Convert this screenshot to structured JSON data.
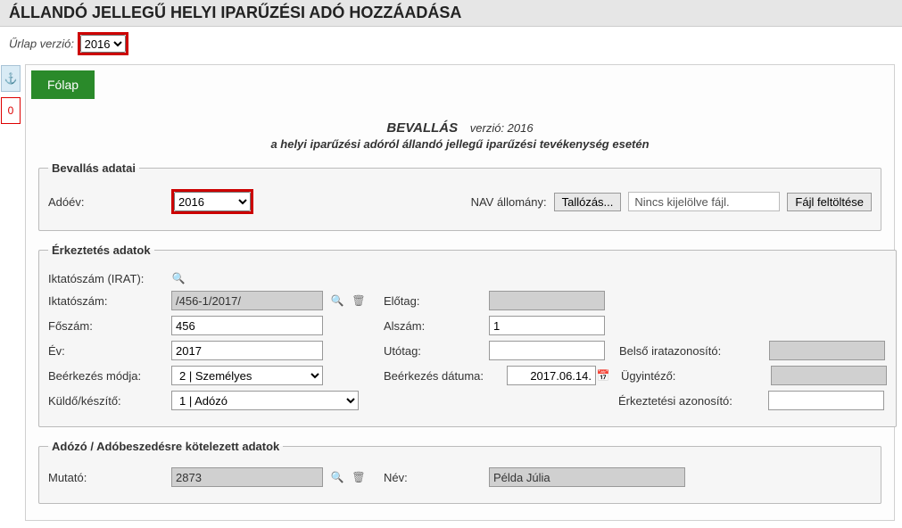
{
  "header": {
    "title": "ÁLLANDÓ JELLEGŰ HELYI IPARŰZÉSI ADÓ HOZZÁADÁSA"
  },
  "version": {
    "label": "Űrlap verzió:",
    "selected": "2016"
  },
  "sideFlags": {
    "anchor_icon": "⚓",
    "error_count": "0"
  },
  "tabs": {
    "main": "Fólap"
  },
  "docTitle": {
    "bevallas": "BEVALLÁS",
    "verzio": "verzió: 2016",
    "subtitle": "a helyi iparűzési adóról állandó jellegű iparűzési tevékenység esetén"
  },
  "group1": {
    "legend": "Bevallás adatai",
    "adoev_label": "Adóév:",
    "adoev_value": "2016",
    "nav_label": "NAV állomány:",
    "browse_btn": "Tallózás...",
    "file_status": "Nincs kijelölve fájl.",
    "upload_btn": "Fájl feltöltése"
  },
  "group2": {
    "legend": "Érkeztetés adatok",
    "iktatoszam_irat_label": "Iktatószám (IRAT):",
    "iktatoszam_label": "Iktatószám:",
    "iktatoszam_value": "/456-1/2017/",
    "elotag_label": "Előtag:",
    "elotag_value": "",
    "foszam_label": "Főszám:",
    "foszam_value": "456",
    "alszam_label": "Alszám:",
    "alszam_value": "1",
    "ev_label": "Év:",
    "ev_value": "2017",
    "utotag_label": "Utótag:",
    "utotag_value": "",
    "belso_label": "Belső iratazonosító:",
    "belso_value": "",
    "beerkezes_modja_label": "Beérkezés módja:",
    "beerkezes_modja_value": "2 | Személyes",
    "beerkezes_datuma_label": "Beérkezés dátuma:",
    "beerkezes_datuma_value": "2017.06.14.",
    "ugyintezo_label": "Ügyintéző:",
    "ugyintezo_value": "",
    "kuldo_label": "Küldő/készítő:",
    "kuldo_value": "1 | Adózó",
    "erk_azon_label": "Érkeztetési azonosító:",
    "erk_azon_value": ""
  },
  "group3": {
    "legend": "Adózó / Adóbeszedésre kötelezett adatok",
    "mutato_label": "Mutató:",
    "mutato_value": "2873",
    "nev_label": "Név:",
    "nev_value": "Példa Júlia"
  }
}
